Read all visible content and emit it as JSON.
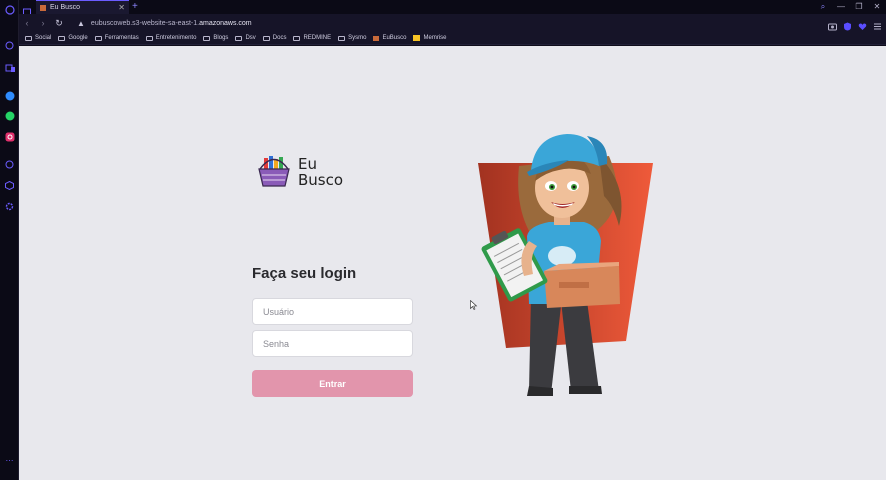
{
  "browser": {
    "tab_title": "Eu Busco",
    "url_prefix": "eubuscoweb.s3-website-sa-east-1.",
    "url_domain": "amazonaws.com",
    "bookmarks": [
      "Social",
      "Google",
      "Ferramentas",
      "Entretenimento",
      "Blogs",
      "Dsv",
      "Docs",
      "REDMINE",
      "Sysmo",
      "EuBusco",
      "Memrise"
    ]
  },
  "login": {
    "logo_line1": "Eu",
    "logo_line2": "Busco",
    "title": "Faça seu login",
    "username_placeholder": "Usuário",
    "password_placeholder": "Senha",
    "submit_label": "Entrar"
  },
  "colors": {
    "accent": "#6b5cff",
    "button": "#e295ac",
    "page_bg": "#e8e8ed"
  }
}
